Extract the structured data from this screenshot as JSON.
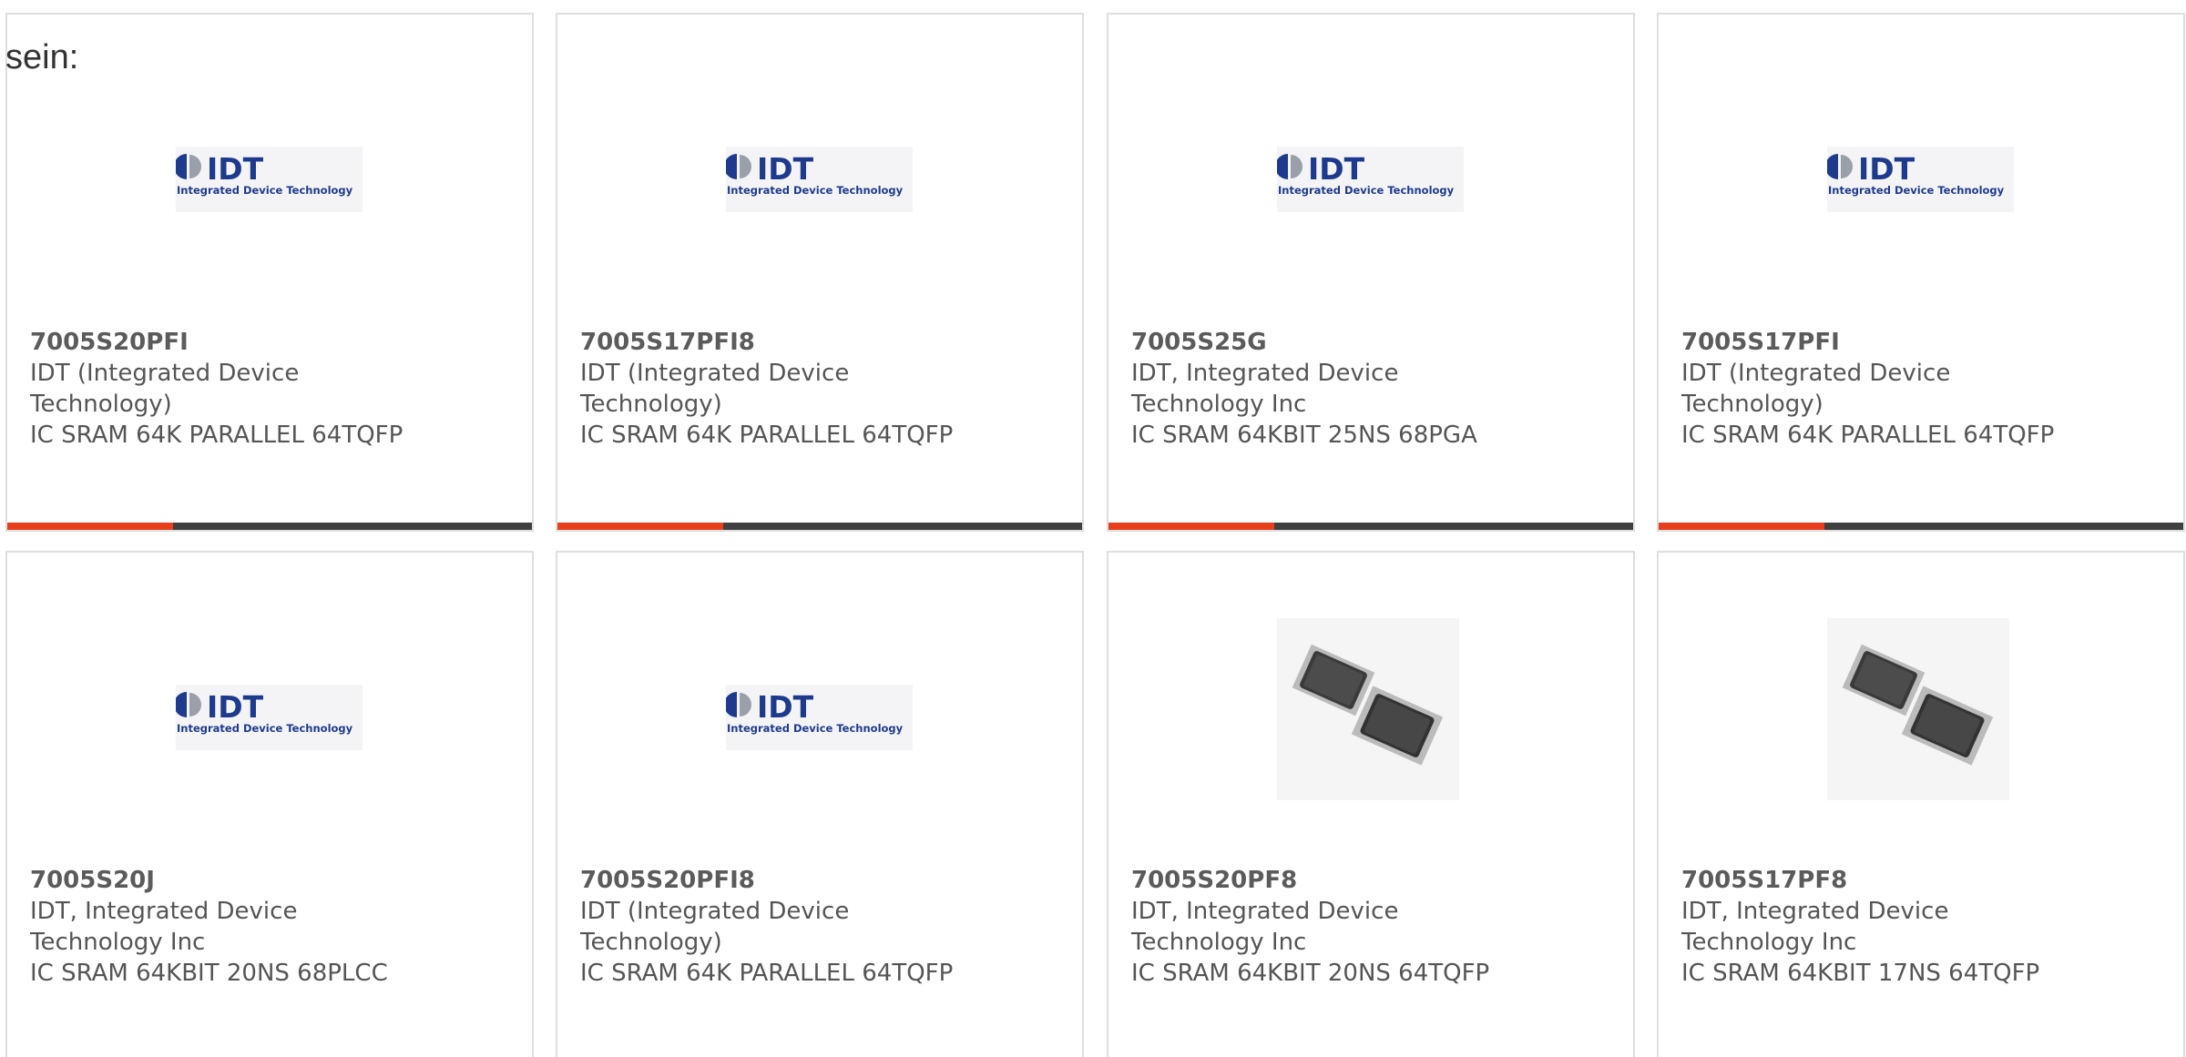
{
  "intro_text": "sein:",
  "logo": {
    "brand": "IDT",
    "tagline": "Integrated Device Technology"
  },
  "products": [
    {
      "part": "7005S20PFI",
      "manufacturer": "IDT (Integrated Device Technology)",
      "description": "IC SRAM 64K PARALLEL 64TQFP",
      "image": "idt-logo"
    },
    {
      "part": "7005S17PFI8",
      "manufacturer": "IDT (Integrated Device Technology)",
      "description": "IC SRAM 64K PARALLEL 64TQFP",
      "image": "idt-logo"
    },
    {
      "part": "7005S25G",
      "manufacturer": "IDT, Integrated Device Technology Inc",
      "description": "IC SRAM 64KBIT 25NS 68PGA",
      "image": "idt-logo"
    },
    {
      "part": "7005S17PFI",
      "manufacturer": "IDT (Integrated Device Technology)",
      "description": "IC SRAM 64K PARALLEL 64TQFP",
      "image": "idt-logo"
    },
    {
      "part": "7005S20J",
      "manufacturer": "IDT, Integrated Device Technology Inc",
      "description": "IC SRAM 64KBIT 20NS 68PLCC",
      "image": "idt-logo"
    },
    {
      "part": "7005S20PFI8",
      "manufacturer": "IDT (Integrated Device Technology)",
      "description": "IC SRAM 64K PARALLEL 64TQFP",
      "image": "idt-logo"
    },
    {
      "part": "7005S20PF8",
      "manufacturer": "IDT, Integrated Device Technology Inc",
      "description": "IC SRAM 64KBIT 20NS 64TQFP",
      "image": "chip-photo"
    },
    {
      "part": "7005S17PF8",
      "manufacturer": "IDT, Integrated Device Technology Inc",
      "description": "IC SRAM 64KBIT 17NS 64TQFP",
      "image": "chip-photo"
    }
  ],
  "colors": {
    "accent": "#e8401f",
    "bar": "#404040",
    "border": "#dedede",
    "logo_blue": "#1e3a8c"
  }
}
